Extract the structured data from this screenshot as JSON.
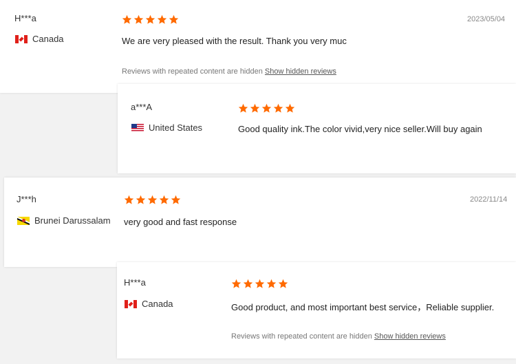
{
  "colors": {
    "star": "#ff6a00",
    "accent_red": "#e0201a"
  },
  "reviews": [
    {
      "user": "H***a",
      "country": "Canada",
      "flag": "canada-flag-icon",
      "rating": 5,
      "date": "2023/05/04",
      "text": "We are very pleased with the result. Thank you very muc",
      "hidden_note": "Reviews with repeated content are hidden",
      "hidden_link": "Show hidden reviews"
    },
    {
      "user": "a***A",
      "country": "United States",
      "flag": "us-flag-icon",
      "rating": 5,
      "text": "Good quality ink.The color vivid,very nice seller.Will buy again"
    },
    {
      "user": "J***h",
      "country": "Brunei Darussalam",
      "flag": "brunei-flag-icon",
      "rating": 5,
      "date": "2022/11/14",
      "text": "very good and fast response"
    },
    {
      "user": "H***a",
      "country": "Canada",
      "flag": "canada-flag-icon",
      "rating": 5,
      "text": "Good product, and most important best service，Reliable supplier.",
      "hidden_note": "Reviews with repeated content are hidden",
      "hidden_link": "Show hidden reviews"
    }
  ]
}
